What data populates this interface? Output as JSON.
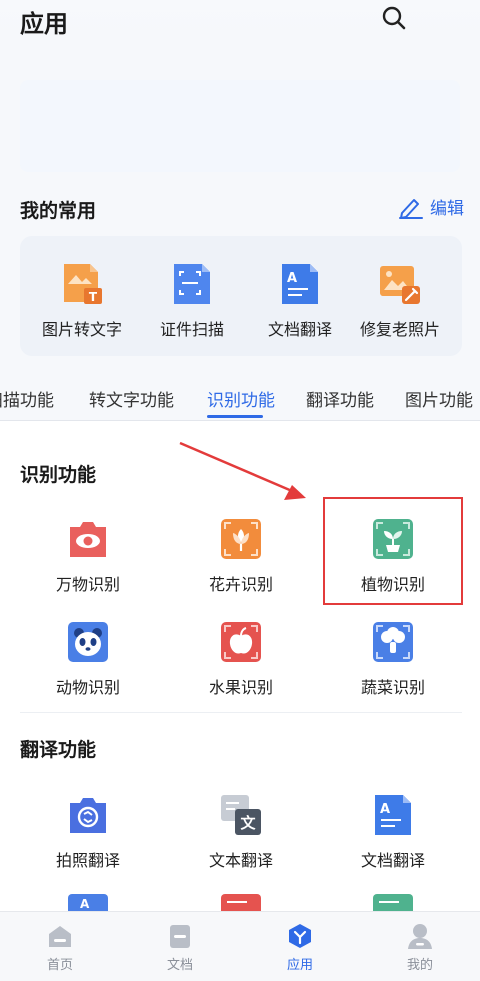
{
  "header": {
    "title": "应用"
  },
  "favorites": {
    "title": "我的常用",
    "edit_label": "编辑",
    "items": [
      {
        "label": "图片转文字",
        "icon": "image-to-text-icon"
      },
      {
        "label": "证件扫描",
        "icon": "id-scan-icon"
      },
      {
        "label": "文档翻译",
        "icon": "document-translate-icon"
      },
      {
        "label": "修复老照片",
        "icon": "photo-repair-icon"
      }
    ]
  },
  "tabs": [
    {
      "label": "扫描功能"
    },
    {
      "label": "转文字功能"
    },
    {
      "label": "识别功能",
      "active": true
    },
    {
      "label": "翻译功能"
    },
    {
      "label": "图片功能"
    }
  ],
  "recognition": {
    "title": "识别功能",
    "items": [
      {
        "label": "万物识别",
        "icon": "eye-camera-icon"
      },
      {
        "label": "花卉识别",
        "icon": "flower-icon"
      },
      {
        "label": "植物识别",
        "icon": "plant-icon"
      },
      {
        "label": "动物识别",
        "icon": "panda-icon"
      },
      {
        "label": "水果识别",
        "icon": "apple-icon"
      },
      {
        "label": "蔬菜识别",
        "icon": "vegetable-icon"
      }
    ]
  },
  "translation": {
    "title": "翻译功能",
    "items": [
      {
        "label": "拍照翻译",
        "icon": "camera-translate-icon"
      },
      {
        "label": "文本翻译",
        "icon": "text-translate-icon"
      },
      {
        "label": "文档翻译",
        "icon": "document-translate-icon"
      }
    ]
  },
  "bottom_nav": [
    {
      "label": "首页",
      "icon": "home-icon"
    },
    {
      "label": "文档",
      "icon": "document-icon"
    },
    {
      "label": "应用",
      "icon": "apps-icon",
      "active": true
    },
    {
      "label": "我的",
      "icon": "profile-icon"
    }
  ],
  "colors": {
    "accent": "#2f6ae6",
    "highlight": "#e33b3b"
  }
}
